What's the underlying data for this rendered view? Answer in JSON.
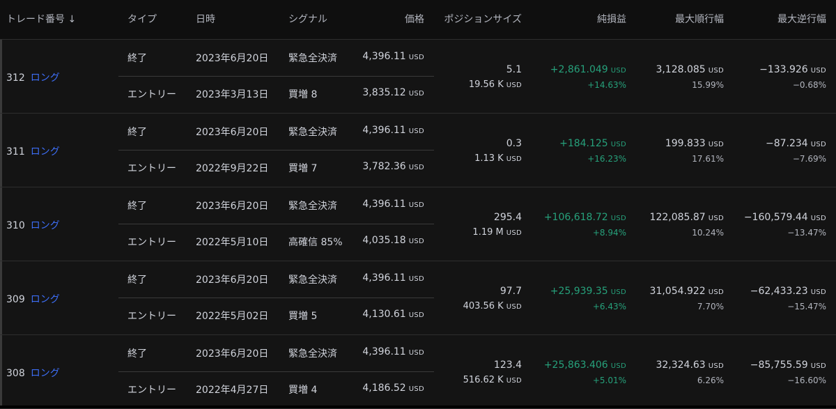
{
  "headers": {
    "trade_no": "トレード番号 ↓",
    "type": "タイプ",
    "datetime": "日時",
    "signal": "シグナル",
    "price": "価格",
    "position_size": "ポジションサイズ",
    "net_pnl": "純損益",
    "max_runup": "最大順行幅",
    "max_drawdown": "最大逆行幅"
  },
  "unit": "USD",
  "trades": [
    {
      "id": "312",
      "direction": "ロング",
      "exit": {
        "type": "終了",
        "date": "2023年6月20日",
        "signal": "緊急全決済",
        "price": "4,396.11"
      },
      "entry": {
        "type": "エントリー",
        "date": "2023年3月13日",
        "signal": "買増 8",
        "price": "3,835.12"
      },
      "qty": "5.1",
      "size_value": "19.56 K",
      "pnl": "+2,861.049",
      "pnl_pct": "+14.63%",
      "runup": "3,128.085",
      "runup_pct": "15.99%",
      "drawdown": "−133.926",
      "drawdown_pct": "−0.68%"
    },
    {
      "id": "311",
      "direction": "ロング",
      "exit": {
        "type": "終了",
        "date": "2023年6月20日",
        "signal": "緊急全決済",
        "price": "4,396.11"
      },
      "entry": {
        "type": "エントリー",
        "date": "2022年9月22日",
        "signal": "買増 7",
        "price": "3,782.36"
      },
      "qty": "0.3",
      "size_value": "1.13 K",
      "pnl": "+184.125",
      "pnl_pct": "+16.23%",
      "runup": "199.833",
      "runup_pct": "17.61%",
      "drawdown": "−87.234",
      "drawdown_pct": "−7.69%"
    },
    {
      "id": "310",
      "direction": "ロング",
      "exit": {
        "type": "終了",
        "date": "2023年6月20日",
        "signal": "緊急全決済",
        "price": "4,396.11"
      },
      "entry": {
        "type": "エントリー",
        "date": "2022年5月10日",
        "signal": "高確信 85%",
        "price": "4,035.18"
      },
      "qty": "295.4",
      "size_value": "1.19 M",
      "pnl": "+106,618.72",
      "pnl_pct": "+8.94%",
      "runup": "122,085.87",
      "runup_pct": "10.24%",
      "drawdown": "−160,579.44",
      "drawdown_pct": "−13.47%"
    },
    {
      "id": "309",
      "direction": "ロング",
      "exit": {
        "type": "終了",
        "date": "2023年6月20日",
        "signal": "緊急全決済",
        "price": "4,396.11"
      },
      "entry": {
        "type": "エントリー",
        "date": "2022年5月02日",
        "signal": "買増 5",
        "price": "4,130.61"
      },
      "qty": "97.7",
      "size_value": "403.56 K",
      "pnl": "+25,939.35",
      "pnl_pct": "+6.43%",
      "runup": "31,054.922",
      "runup_pct": "7.70%",
      "drawdown": "−62,433.23",
      "drawdown_pct": "−15.47%"
    },
    {
      "id": "308",
      "direction": "ロング",
      "exit": {
        "type": "終了",
        "date": "2023年6月20日",
        "signal": "緊急全決済",
        "price": "4,396.11"
      },
      "entry": {
        "type": "エントリー",
        "date": "2022年4月27日",
        "signal": "買増 4",
        "price": "4,186.52"
      },
      "qty": "123.4",
      "size_value": "516.62 K",
      "pnl": "+25,863.406",
      "pnl_pct": "+5.01%",
      "runup": "32,324.63",
      "runup_pct": "6.26%",
      "drawdown": "−85,755.59",
      "drawdown_pct": "−16.60%"
    }
  ]
}
